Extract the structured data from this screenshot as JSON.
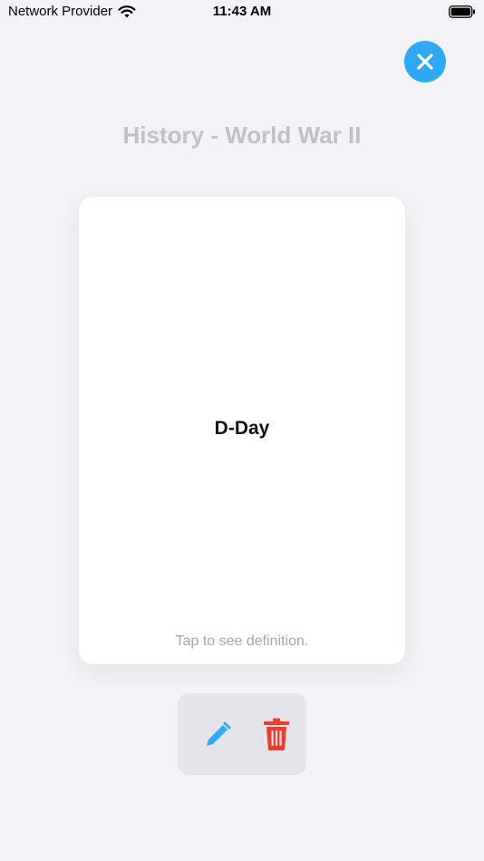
{
  "status_bar": {
    "carrier": "Network Provider",
    "time": "11:43 AM",
    "wifi_icon": "wifi-icon",
    "battery_icon": "battery-icon"
  },
  "header": {
    "close_icon": "close-icon",
    "title": "History - World War II"
  },
  "card": {
    "term": "D-Day",
    "hint": "Tap to see definition."
  },
  "actions": {
    "edit_icon": "pencil-icon",
    "delete_icon": "trash-icon"
  },
  "colors": {
    "background": "#f2f2f7",
    "accent": "#2fa8f5",
    "delete": "#f23b2f",
    "title": "#c2c2c5"
  }
}
